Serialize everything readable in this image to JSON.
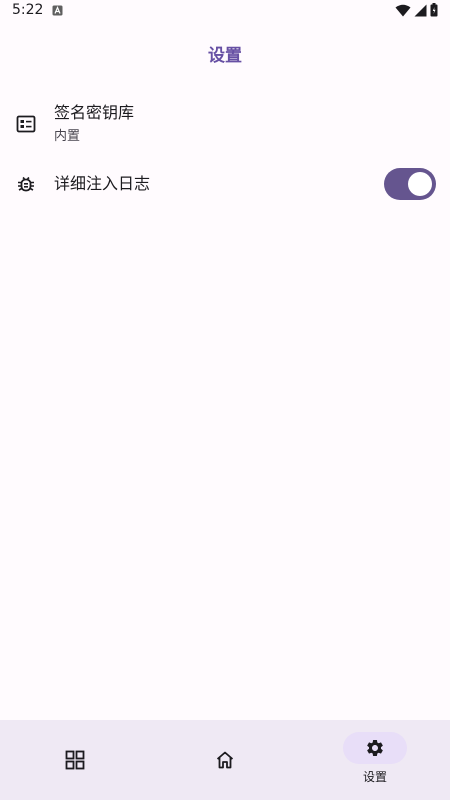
{
  "status_bar": {
    "time": "5:22"
  },
  "app_bar": {
    "title": "设置"
  },
  "settings": {
    "keystore": {
      "title": "签名密钥库",
      "subtitle": "内置"
    },
    "verbose_log": {
      "title": "详细注入日志",
      "enabled": true
    }
  },
  "bottom_nav": {
    "items": [
      {
        "icon": "grid-icon"
      },
      {
        "icon": "home-icon"
      },
      {
        "icon": "gear-icon",
        "label": "设置",
        "active": true
      }
    ]
  },
  "colors": {
    "background": "#fffbfe",
    "accent": "#6750a4",
    "toggle_track": "#65558f",
    "nav_background": "#efe9f4",
    "nav_active_pill": "#e8def8"
  }
}
